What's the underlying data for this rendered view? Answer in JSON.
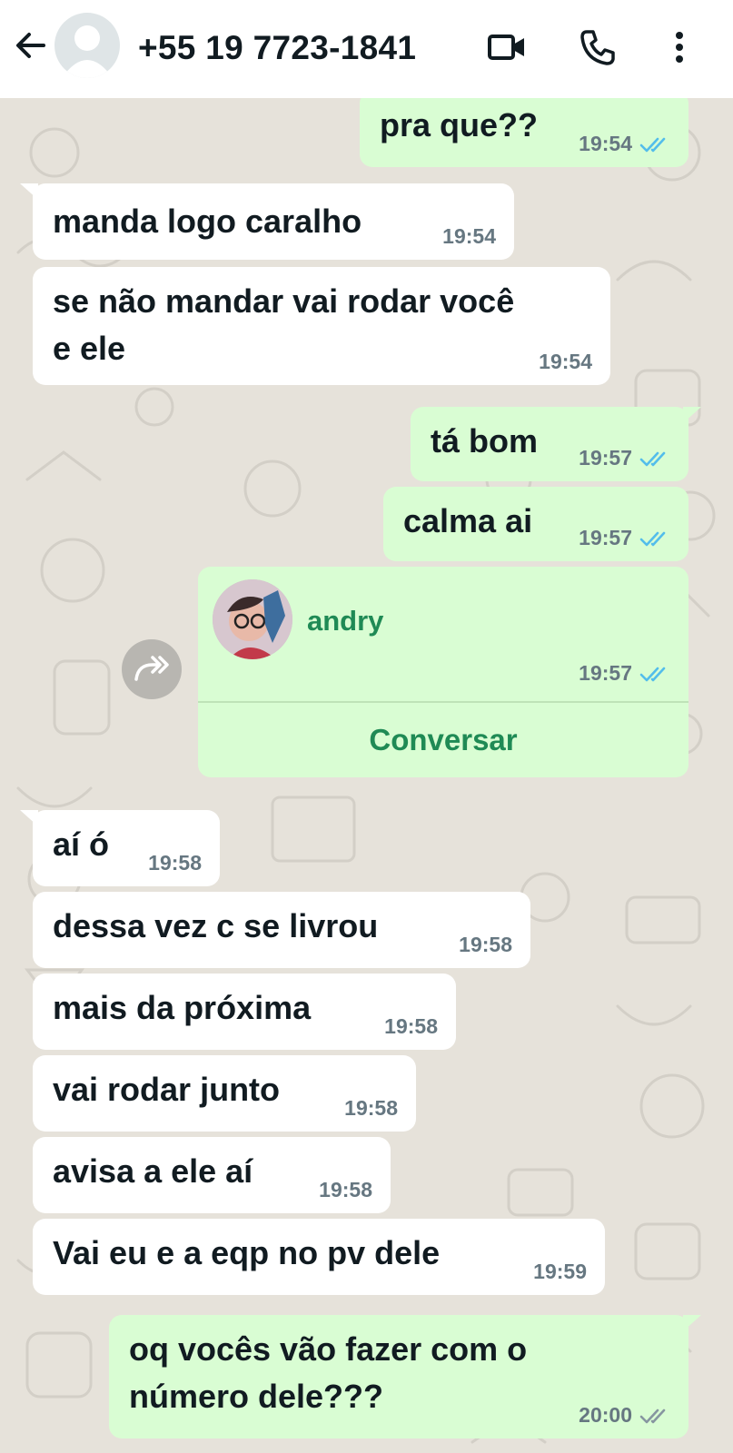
{
  "header": {
    "back_icon": "arrow-left-icon",
    "avatar_icon": "default-avatar-icon",
    "title": "+55 19 7723-1841",
    "video_icon": "video-camera-icon",
    "call_icon": "phone-icon",
    "menu_icon": "more-vertical-icon"
  },
  "colors": {
    "incoming": "#ffffff",
    "outgoing": "#d9fdd3",
    "read_ticks": "#53bdeb",
    "delivered_ticks": "#8696a0",
    "accent_green": "#1f8a55"
  },
  "messages": [
    {
      "dir": "out",
      "text": "pra que??",
      "time": "19:54",
      "status": "read"
    },
    {
      "dir": "in",
      "text": "manda logo caralho",
      "time": "19:54"
    },
    {
      "dir": "in",
      "text": "se não mandar vai rodar você\ne ele",
      "time": "19:54"
    },
    {
      "dir": "out",
      "text": "tá bom",
      "time": "19:57",
      "status": "read"
    },
    {
      "dir": "out",
      "text": "calma ai",
      "time": "19:57",
      "status": "read"
    },
    {
      "dir": "in",
      "text": "aí ó",
      "time": "19:58"
    },
    {
      "dir": "in",
      "text": "dessa vez c se livrou",
      "time": "19:58"
    },
    {
      "dir": "in",
      "text": "mais da próxima",
      "time": "19:58"
    },
    {
      "dir": "in",
      "text": "vai rodar junto",
      "time": "19:58"
    },
    {
      "dir": "in",
      "text": "avisa a ele aí",
      "time": "19:58"
    },
    {
      "dir": "in",
      "text": "Vai eu e a eqp no pv dele",
      "time": "19:59"
    },
    {
      "dir": "out",
      "text": "oq vocês vão fazer com o\nnúmero dele???",
      "time": "20:00",
      "status": "delivered"
    }
  ],
  "contact_card": {
    "name": "andry",
    "time": "19:57",
    "status": "read",
    "action": "Conversar",
    "forward_icon": "forward-arrow-icon"
  }
}
